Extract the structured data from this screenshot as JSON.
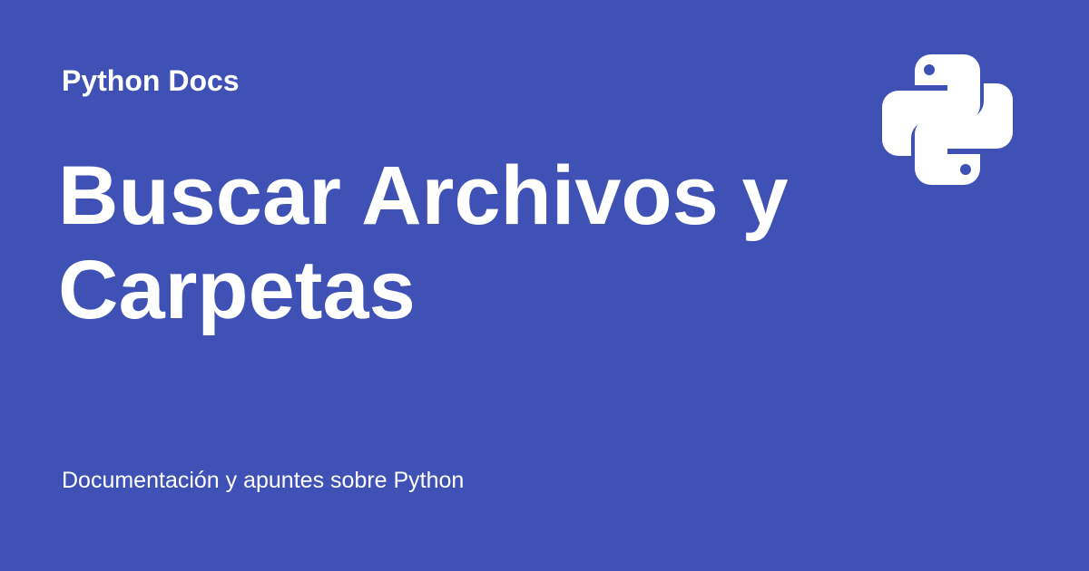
{
  "colors": {
    "background": "#3f51b5",
    "text": "#ffffff"
  },
  "header": {
    "site_name": "Python Docs",
    "logo_icon": "python-logo-icon"
  },
  "main": {
    "title_line_1": "Buscar Archivos y",
    "title_line_2": "Carpetas"
  },
  "footer": {
    "tagline": "Documentación y apuntes sobre Python"
  }
}
